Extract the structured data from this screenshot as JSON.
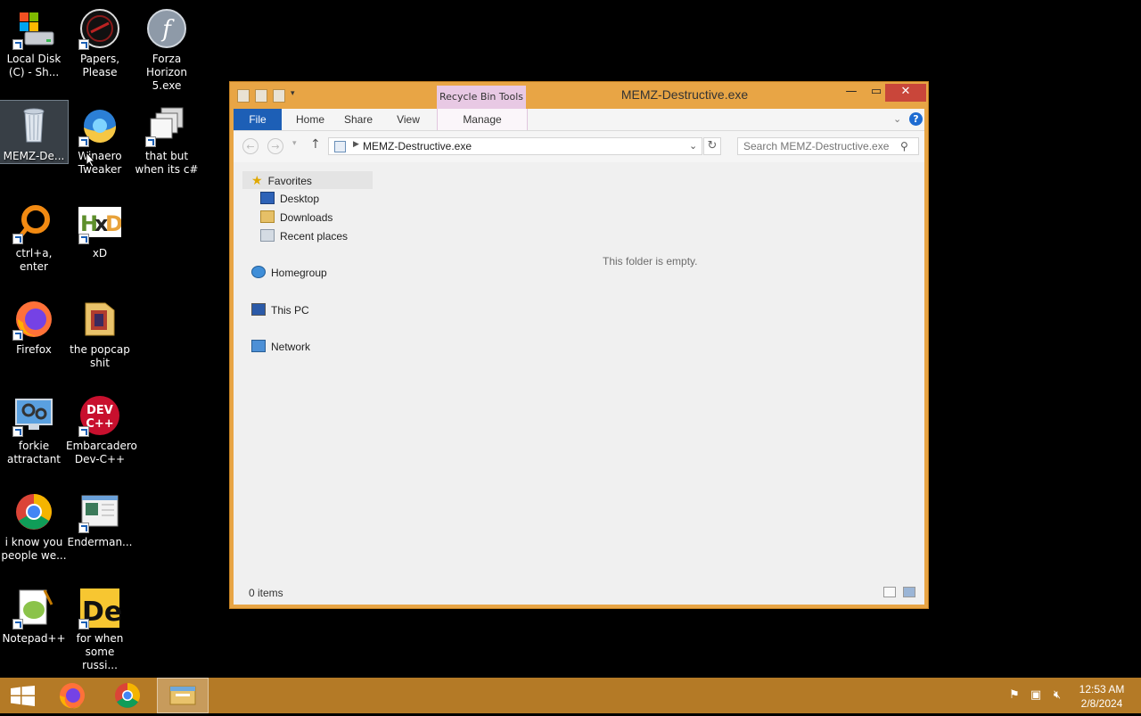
{
  "desktop": {
    "icons": [
      {
        "label": "Local Disk (C) - Sh...",
        "icon": "hard-drive-icon"
      },
      {
        "label": "Papers, Please",
        "icon": "papers-please-icon"
      },
      {
        "label": "Forza Horizon 5.exe",
        "icon": "flash-icon"
      },
      {
        "label": "MEMZ-De...",
        "icon": "recycle-bin-icon"
      },
      {
        "label": "Winaero Tweaker",
        "icon": "winaero-icon"
      },
      {
        "label": "that but when its c#",
        "icon": "copy-windows-icon"
      },
      {
        "label": "ctrl+a, enter",
        "icon": "ring-icon"
      },
      {
        "label": "xD",
        "icon": "hxd-icon"
      },
      {
        "label": "Firefox",
        "icon": "firefox-icon"
      },
      {
        "label": "the popcap shit",
        "icon": "folder-icon"
      },
      {
        "label": "forkie attractant",
        "icon": "gears-monitor-icon"
      },
      {
        "label": "Embarcadero Dev-C++",
        "icon": "devcpp-icon"
      },
      {
        "label": "i know you people we...",
        "icon": "chrome-icon"
      },
      {
        "label": "Enderman...",
        "icon": "window-app-icon"
      },
      {
        "label": "Notepad++",
        "icon": "notepadpp-icon"
      },
      {
        "label": "for when some russi...",
        "icon": "de-icon"
      }
    ]
  },
  "window": {
    "title": "MEMZ-Destructive.exe",
    "contextual_tab": "Recycle Bin Tools",
    "tabs": {
      "file": "File",
      "home": "Home",
      "share": "Share",
      "view": "View",
      "manage": "Manage"
    },
    "address_path": "MEMZ-Destructive.exe",
    "search_placeholder": "Search MEMZ-Destructive.exe",
    "nav": {
      "favorites": "Favorites",
      "desktop": "Desktop",
      "downloads": "Downloads",
      "recent": "Recent places",
      "homegroup": "Homegroup",
      "this_pc": "This PC",
      "network": "Network"
    },
    "empty_message": "This folder is empty.",
    "status": "0 items",
    "colors": {
      "frame": "#e8a545",
      "file_tab": "#1d5fb6",
      "context_tab": "#e8c9e4"
    }
  },
  "taskbar": {
    "time": "12:53 AM",
    "date": "2/8/2024",
    "color": "#b47a26"
  }
}
